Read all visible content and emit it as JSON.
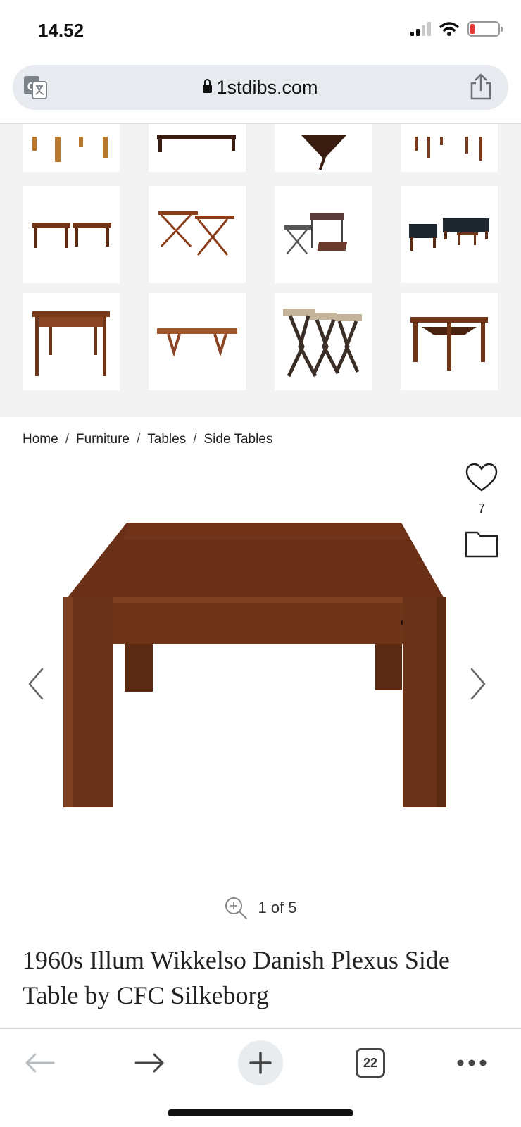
{
  "status_bar": {
    "time": "14.52",
    "battery_level": 0.15,
    "battery_color": "#e53935"
  },
  "browser": {
    "url": "1stdibs.com",
    "icons": [
      "translate-icon",
      "lock-icon",
      "share-icon"
    ],
    "toolbar": {
      "tab_count": "22",
      "icons": [
        "back-arrow-icon",
        "forward-arrow-icon",
        "plus-icon",
        "tabs-icon",
        "more-icon"
      ]
    }
  },
  "breadcrumb": {
    "items": [
      "Home",
      "Furniture",
      "Tables",
      "Side Tables"
    ],
    "separator": "/"
  },
  "product": {
    "favorite_count": "7",
    "image_counter": "1 of 5",
    "title": "1960s Illum Wikkelso Danish Plexus Side Table by CFC Silkeborg"
  },
  "colors": {
    "wood": "#6e3519",
    "wood_dark": "#4a2210",
    "grid_bg": "#f3f3f3",
    "url_bar_bg": "#e7eaee"
  }
}
